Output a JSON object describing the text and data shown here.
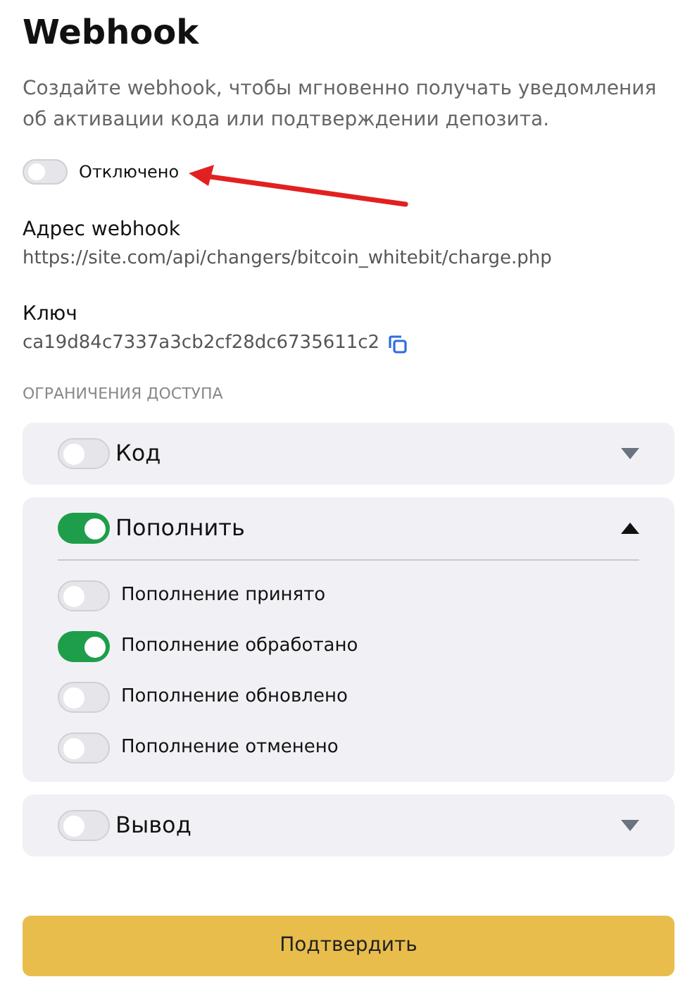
{
  "title": "Webhook",
  "description": "Создайте webhook, чтобы мгновенно получать уведомления об активации кода или подтверждении депозита.",
  "main_toggle": {
    "label": "Отключено",
    "on": false
  },
  "fields": [
    {
      "label": "Адрес webhook",
      "value": "https://site.com/api/changers/bitcoin_whitebit/charge.php",
      "copyable": false
    },
    {
      "label": "Ключ",
      "value": "ca19d84c7337a3cb2cf28dc6735611c2",
      "copyable": true
    }
  ],
  "section_heading": "ОГРАНИЧЕНИЯ ДОСТУПА",
  "groups": [
    {
      "label": "Код",
      "on": false,
      "expanded": false
    },
    {
      "label": "Пополнить",
      "on": true,
      "expanded": true,
      "children": [
        {
          "label": "Пополнение принято",
          "on": false
        },
        {
          "label": "Пополнение обработано",
          "on": true
        },
        {
          "label": "Пополнение обновлено",
          "on": false
        },
        {
          "label": "Пополнение отменено",
          "on": false
        }
      ]
    },
    {
      "label": "Вывод",
      "on": false,
      "expanded": false
    }
  ],
  "submit_button": "Подтвердить"
}
